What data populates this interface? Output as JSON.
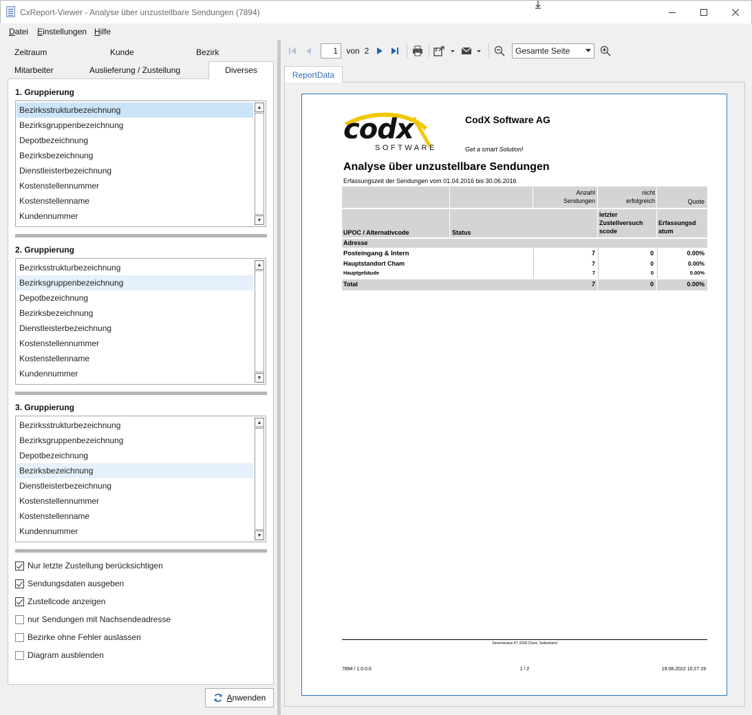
{
  "window": {
    "title": "CxReport-Viewer - Analyse über unzustellbare Sendungen (7894)",
    "controls": [
      "minimize",
      "maximize",
      "close"
    ]
  },
  "menu": [
    {
      "key": "D",
      "rest": "atei"
    },
    {
      "key": "E",
      "rest": "instellungen"
    },
    {
      "key": "H",
      "rest": "ilfe"
    }
  ],
  "filter_tabs": {
    "row1": [
      "Zeitraum",
      "Kunde",
      "Bezirk"
    ],
    "row2": [
      "Mitarbeiter",
      "Auslieferung / Zustellung",
      "Diverses"
    ],
    "active": "Diverses"
  },
  "groupings": [
    {
      "title": "1. Gruppierung",
      "items": [
        "Bezirksstrukturbezeichnung",
        "Bezirksgruppenbezeichnung",
        "Depotbezeichnung",
        "Bezirksbezeichnung",
        "Dienstleisterbezeichnung",
        "Kostenstellennummer",
        "Kostenstellenname",
        "Kundennummer"
      ],
      "selected": "Bezirksstrukturbezeichnung"
    },
    {
      "title": "2. Gruppierung",
      "items": [
        "Bezirksstrukturbezeichnung",
        "Bezirksgruppenbezeichnung",
        "Depotbezeichnung",
        "Bezirksbezeichnung",
        "Dienstleisterbezeichnung",
        "Kostenstellennummer",
        "Kostenstellenname",
        "Kundennummer"
      ],
      "selected": "Bezirksgruppenbezeichnung"
    },
    {
      "title": "3. Gruppierung",
      "items": [
        "Bezirksstrukturbezeichnung",
        "Bezirksgruppenbezeichnung",
        "Depotbezeichnung",
        "Bezirksbezeichnung",
        "Dienstleisterbezeichnung",
        "Kostenstellennummer",
        "Kostenstellenname",
        "Kundennummer"
      ],
      "selected": "Bezirksbezeichnung"
    }
  ],
  "options": [
    {
      "label": "Nur letzte Zustellung berücksichtigen",
      "checked": true
    },
    {
      "label": "Sendungsdaten ausgeben",
      "checked": true
    },
    {
      "label": "Zustellcode anzeigen",
      "checked": true
    },
    {
      "label": "nur Sendungen mit Nachsendeadresse",
      "checked": false
    },
    {
      "label": "Bezirke ohne Fehler auslassen",
      "checked": false
    },
    {
      "label": "Diagram ausblenden",
      "checked": false
    }
  ],
  "apply_button": {
    "key": "A",
    "rest": "nwenden"
  },
  "toolbar": {
    "page": "1",
    "of_label": "von",
    "total_pages": "2",
    "zoom": "Gesamte Seite"
  },
  "report_tab": "ReportData",
  "report": {
    "logo_main": "codx",
    "logo_sub": "SOFTWARE",
    "company": "CodX Software AG",
    "slogan": "Get a smart Solution!",
    "title": "Analyse über unzustellbare Sendungen",
    "subtitle": "Erfassungszeit der Sendungen vom 01.04.2016 bis 30.06.2016",
    "header1": {
      "col3a": "Anzahl",
      "col3b": "Sendungen",
      "col4a": "nicht",
      "col4b": "erfolgreich",
      "col5": "Quote"
    },
    "header2": {
      "col1": "UPOC / Alternativcode",
      "col2": "Status",
      "col4a": "letzter",
      "col4b": "Zustellversuch",
      "col4c": "scode",
      "col5a": "Erfassungsd",
      "col5b": "atum"
    },
    "header3": "Adresse",
    "rows": [
      {
        "name": "Posteingang & Intern",
        "count": "7",
        "failed": "0",
        "quote": "0.00%"
      },
      {
        "name": "Hauptstandort Cham",
        "count": "7",
        "failed": "0",
        "quote": "0.00%"
      },
      {
        "name": "Hauptgebäude",
        "count": "7",
        "failed": "0",
        "quote": "0.00%"
      }
    ],
    "total": {
      "label": "Total",
      "count": "7",
      "failed": "0",
      "quote": "0.00%"
    },
    "footer_address": "Sinserstrasse 47, 6330 Cham, Switzerland",
    "footer_left": "7894 / 1.0.0.0",
    "footer_center": "1 / 2",
    "footer_right": "19.08.2022 10:27:19"
  }
}
